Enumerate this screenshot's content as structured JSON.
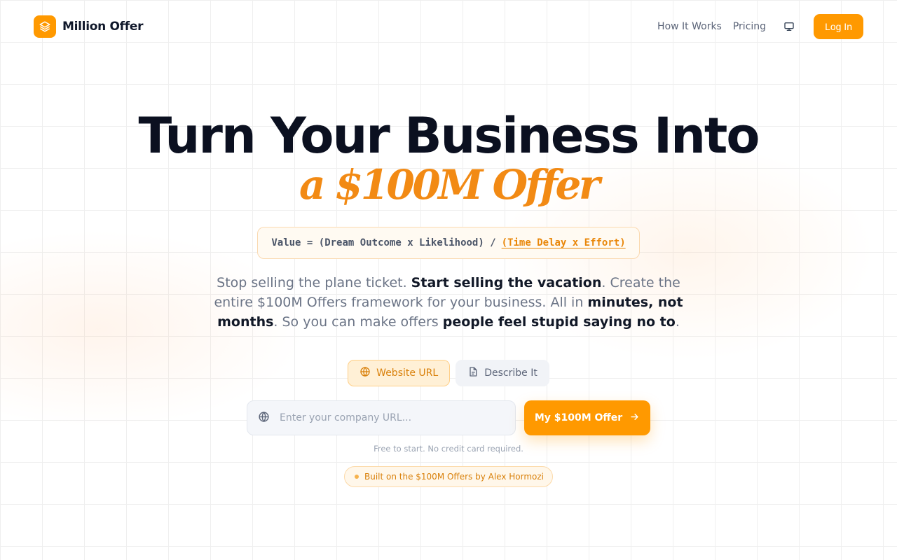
{
  "brand": {
    "name": "Million Offer",
    "logo_icon": "layers-icon",
    "accent_color": "#ff9900"
  },
  "nav": {
    "links": [
      "How It Works",
      "Pricing"
    ],
    "theme_icon": "monitor-icon",
    "login_label": "Log In"
  },
  "hero": {
    "headline": "Turn Your Business Into",
    "headline_accent": "a $100M Offer",
    "formula_main": "Value = (Dream Outcome x Likelihood) /",
    "formula_highlight": "(Time Delay x Effort)",
    "subtitle": {
      "p1": "Stop selling the plane ticket. ",
      "b1": "Start selling the vacation",
      "p2": ". Create the entire $100M Offers framework for your business. All in ",
      "b2": "minutes, not months",
      "p3": ". So you can make offers ",
      "b3": "people feel stupid saying no to",
      "p4": "."
    }
  },
  "modes": [
    {
      "label": "Website URL",
      "icon": "globe-icon",
      "active": true
    },
    {
      "label": "Describe It",
      "icon": "document-icon",
      "active": false
    }
  ],
  "url_input": {
    "placeholder": "Enter your company URL...",
    "value": "",
    "icon": "globe-icon"
  },
  "cta": {
    "label": "My $100M Offer",
    "icon": "arrow-right-icon"
  },
  "fineprint": "Free to start. No credit card required.",
  "badge": {
    "label": "Built on the $100M Offers by Alex Hormozi"
  }
}
